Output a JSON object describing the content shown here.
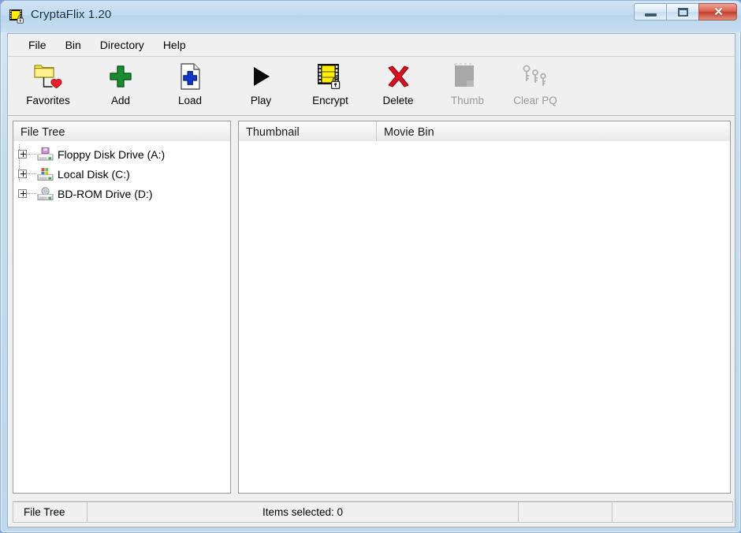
{
  "window": {
    "title": "CryptaFlix 1.20",
    "icon": "film-lock-icon",
    "controls": {
      "minimize": "minimize-button",
      "restore": "restore-button",
      "close": "close-button",
      "close_glyph": "✕"
    }
  },
  "menubar": {
    "items": [
      {
        "label": "File"
      },
      {
        "label": "Bin"
      },
      {
        "label": "Directory"
      },
      {
        "label": "Help"
      }
    ]
  },
  "toolbar": {
    "buttons": [
      {
        "label": "Favorites",
        "icon": "folder-heart-icon",
        "enabled": true
      },
      {
        "label": "Add",
        "icon": "green-plus-icon",
        "enabled": true
      },
      {
        "label": "Load",
        "icon": "page-blue-plus-icon",
        "enabled": true
      },
      {
        "label": "Play",
        "icon": "play-triangle-icon",
        "enabled": true
      },
      {
        "label": "Encrypt",
        "icon": "film-lock-icon",
        "enabled": true
      },
      {
        "label": "Delete",
        "icon": "red-x-icon",
        "enabled": true
      },
      {
        "label": "Thumb",
        "icon": "thumbnail-icon",
        "enabled": false
      },
      {
        "label": "Clear PQ",
        "icon": "keys-icon",
        "enabled": false
      }
    ]
  },
  "left_pane": {
    "header": "File Tree",
    "tree_items": [
      {
        "label": "Floppy Disk Drive (A:)",
        "icon": "floppy-drive-icon",
        "expander": "plus"
      },
      {
        "label": "Local Disk (C:)",
        "icon": "hard-disk-icon",
        "expander": "plus"
      },
      {
        "label": "BD-ROM Drive (D:)",
        "icon": "optical-drive-icon",
        "expander": "plus"
      }
    ]
  },
  "right_pane": {
    "columns": [
      {
        "label": "Thumbnail"
      },
      {
        "label": "Movie Bin"
      }
    ],
    "rows": []
  },
  "statusbar": {
    "pane1": "File Tree",
    "pane2": "Items selected: 0",
    "pane3": "",
    "pane4": ""
  },
  "colors": {
    "titlebar": "#c2dbef",
    "close_button": "#c23f2c",
    "toolbar_bg": "#f0f0f0",
    "pane_bg": "#ffffff",
    "accent_yellow": "#ffee00",
    "accent_red": "#e8202a",
    "accent_green": "#1c8a2e",
    "accent_blue": "#1035c8",
    "disabled_gray": "#9a9a9a"
  }
}
